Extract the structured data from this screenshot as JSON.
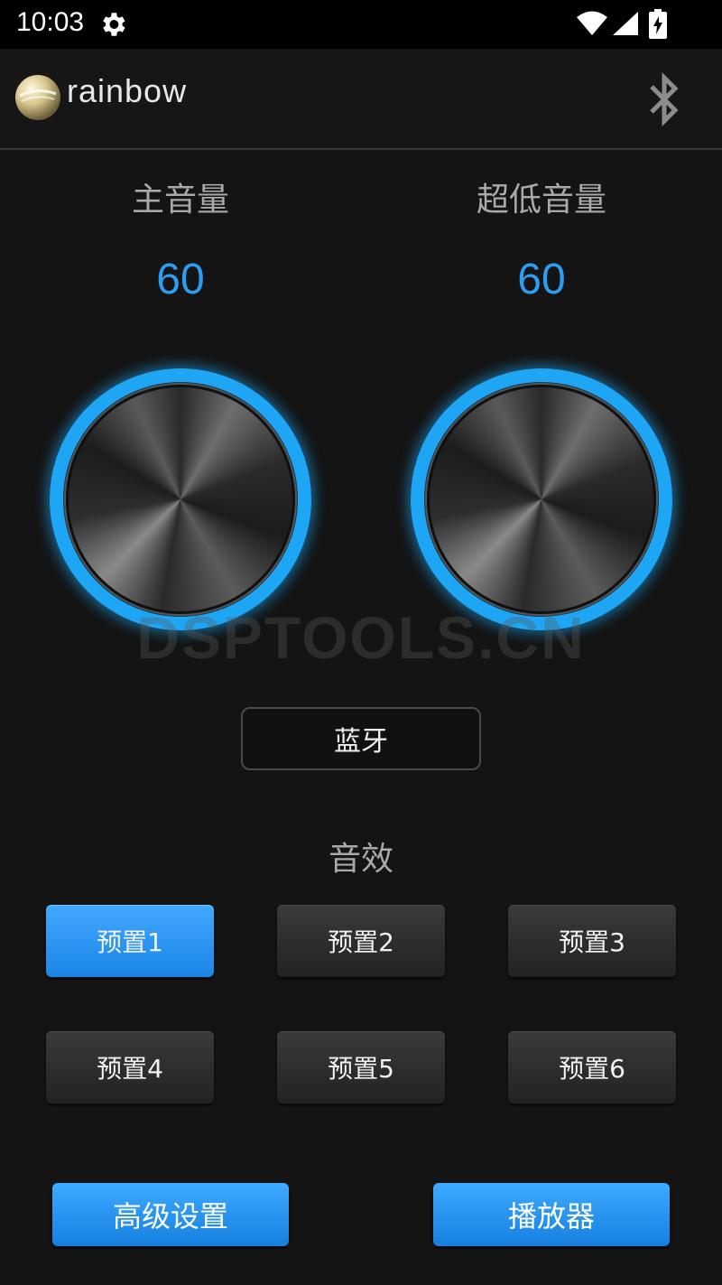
{
  "status_bar": {
    "time": "10:03",
    "icons": [
      "gear-icon",
      "wifi-icon",
      "signal-icon",
      "battery-charging-icon"
    ]
  },
  "header": {
    "logo_text": "rainbow",
    "bluetooth_icon": "bluetooth-icon"
  },
  "volume": {
    "main": {
      "label": "主音量",
      "value": "60"
    },
    "sub": {
      "label": "超低音量",
      "value": "60"
    }
  },
  "watermark": "DSPTOOLS.CN",
  "bluetooth_button": {
    "label": "蓝牙"
  },
  "effects": {
    "title": "音效",
    "presets": [
      {
        "label": "预置1",
        "active": true
      },
      {
        "label": "预置2",
        "active": false
      },
      {
        "label": "预置3",
        "active": false
      },
      {
        "label": "预置4",
        "active": false
      },
      {
        "label": "预置5",
        "active": false
      },
      {
        "label": "预置6",
        "active": false
      }
    ]
  },
  "bottom": {
    "advanced_label": "高级设置",
    "player_label": "播放器"
  },
  "colors": {
    "accent": "#1ea6f5",
    "value_text": "#2d9df1",
    "button_active": "#2b95f0",
    "background": "#141414"
  }
}
